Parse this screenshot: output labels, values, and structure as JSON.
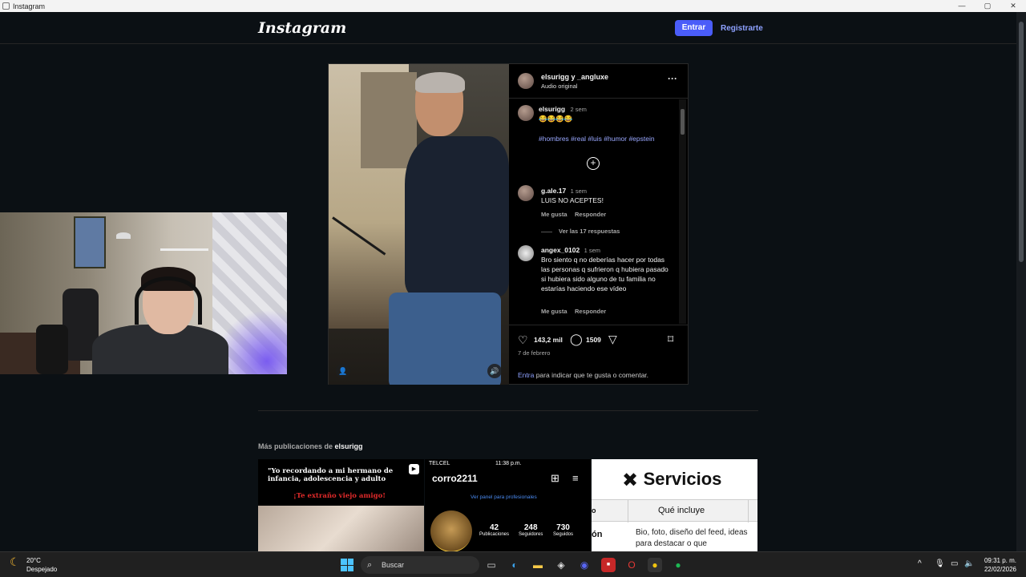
{
  "window": {
    "title": "Instagram",
    "controls": [
      "—",
      "▢",
      "✕"
    ]
  },
  "nav": {
    "logo": "Instagram",
    "login_label": "Entrar",
    "signup_label": "Registrarte"
  },
  "post": {
    "author": "elsurigg y _angluxe",
    "audio": "Audio original",
    "more": "···",
    "caption": {
      "user": "elsurigg",
      "time": "2 sem",
      "emojis": "😂😂😂😂",
      "hashtags": "#hombres #real #luis #humor #epstein"
    },
    "comments": [
      {
        "user": "g.ale.17",
        "time": "1 sem",
        "text": "LUIS NO ACEPTES!",
        "like_label": "Me gusta",
        "reply_label": "Responder",
        "view_replies": "Ver las 17 respuestas"
      },
      {
        "user": "angex_0102",
        "time": "1 sem",
        "text": "Bro siento q no deberías hacer por todas las personas q sufrieron q hubiera pasado si hubiera sido alguno de tu familia no estarías haciendo ese vídeo",
        "like_label": "Me gusta",
        "reply_label": "Responder"
      }
    ],
    "likes": "143,2 mil",
    "comment_count": "1509",
    "date": "7 de febrero",
    "footer_link": "Entra",
    "footer_text": " para indicar que te gusta o comentar."
  },
  "more_posts": {
    "title_prefix": "Más publicaciones de ",
    "title_user": "elsurigg",
    "thumb1": {
      "caption": "\"Yo recordando a mi hermano de infancia, adolescencia y adulto",
      "red_text": "¡Te extraño viejo amigo!"
    },
    "thumb2": {
      "carrier": "TELCEL",
      "time": "11:38 p.m.",
      "handle": "corro2211",
      "panel": "Ver panel para profesionales",
      "stats": [
        {
          "n": "42",
          "l": "Publicaciones"
        },
        {
          "n": "248",
          "l": "Seguidores"
        },
        {
          "n": "730",
          "l": "Seguidos"
        }
      ]
    },
    "thumb3": {
      "title": "Servicios",
      "col_a": "o",
      "col_b": "Qué incluye",
      "row_a": "ón",
      "row_b": "Bio, foto, diseño del feed, ideas para destacar o que"
    }
  },
  "taskbar": {
    "temp": "20°C",
    "weather": "Despejado",
    "search_placeholder": "Buscar",
    "time": "09:31 p. m.",
    "date": "22/02/2026"
  },
  "colors": {
    "accent": "#4a5df9",
    "link": "#8ea1ff",
    "background": "#0b1014"
  }
}
